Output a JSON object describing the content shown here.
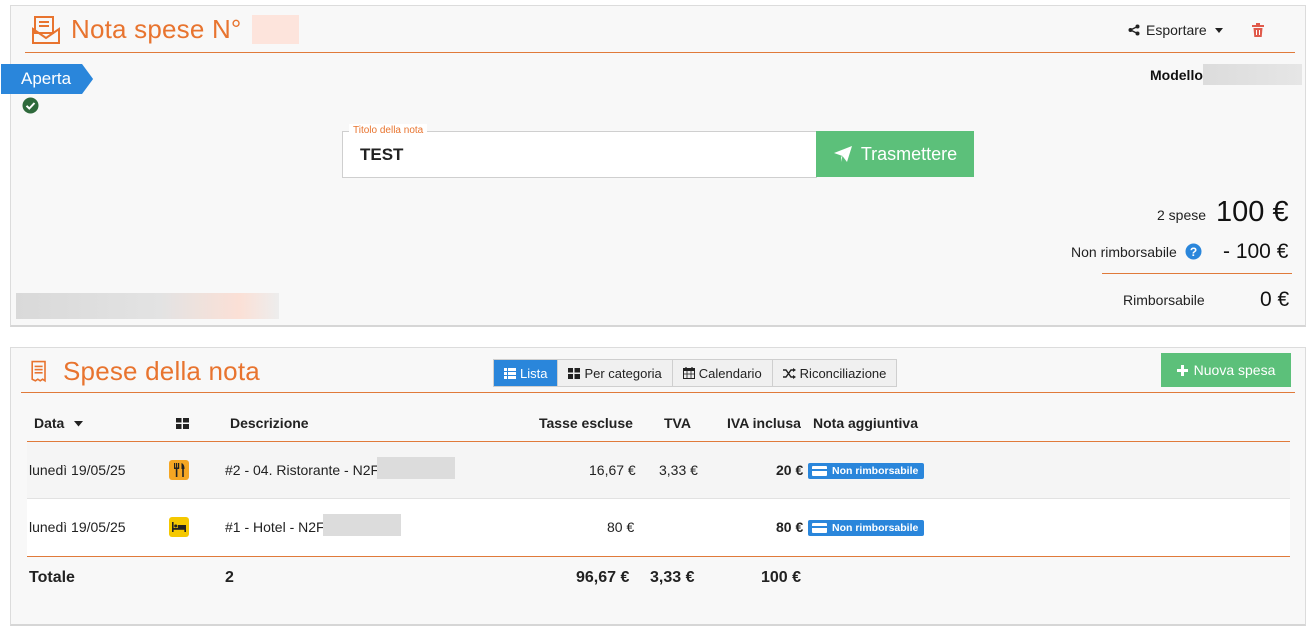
{
  "note": {
    "title": "Nota spese N°",
    "export_label": "Esportare",
    "status": "Aperta",
    "modello_label": "Modello",
    "titolo_label": "Titolo della nota",
    "titolo_value": "TEST",
    "send_label": "Trasmettere",
    "summary": {
      "count_label": "2 spese",
      "total": "100 €",
      "non_rimb_label": "Non rimborsabile",
      "non_rimb_value": "- 100 €",
      "rimb_label": "Rimborsabile",
      "rimb_value": "0 €"
    }
  },
  "expenses": {
    "title": "Spese della nota",
    "tabs": [
      {
        "label": "Lista",
        "icon": "list-icon",
        "active": true
      },
      {
        "label": "Per categoria",
        "icon": "grid-icon",
        "active": false
      },
      {
        "label": "Calendario",
        "icon": "calendar-icon",
        "active": false
      },
      {
        "label": "Riconciliazione",
        "icon": "shuffle-icon",
        "active": false
      }
    ],
    "new_label": "Nuova spesa",
    "columns": {
      "data": "Data",
      "descrizione": "Descrizione",
      "tasse_escluse": "Tasse escluse",
      "tva": "TVA",
      "iva_inclusa": "IVA inclusa",
      "nota": "Nota aggiuntiva"
    },
    "rows": [
      {
        "date": "lunedì 19/05/25",
        "category_icon": "restaurant-icon",
        "description": "#2 - 04. Ristorante - N2F",
        "excl": "16,67 €",
        "tva": "3,33 €",
        "incl": "20 €",
        "badge": "Non rimborsabile"
      },
      {
        "date": "lunedì 19/05/25",
        "category_icon": "hotel-icon",
        "description": "#1 - Hotel - N2F",
        "excl": "80 €",
        "tva": "",
        "incl": "80 €",
        "badge": "Non rimborsabile"
      }
    ],
    "totals": {
      "label": "Totale",
      "count": "2",
      "excl": "96,67 €",
      "tva": "3,33 €",
      "incl": "100 €"
    }
  },
  "colors": {
    "accent_orange": "#e8742f",
    "primary_blue": "#2a86db",
    "success_green": "#5cc07a"
  }
}
